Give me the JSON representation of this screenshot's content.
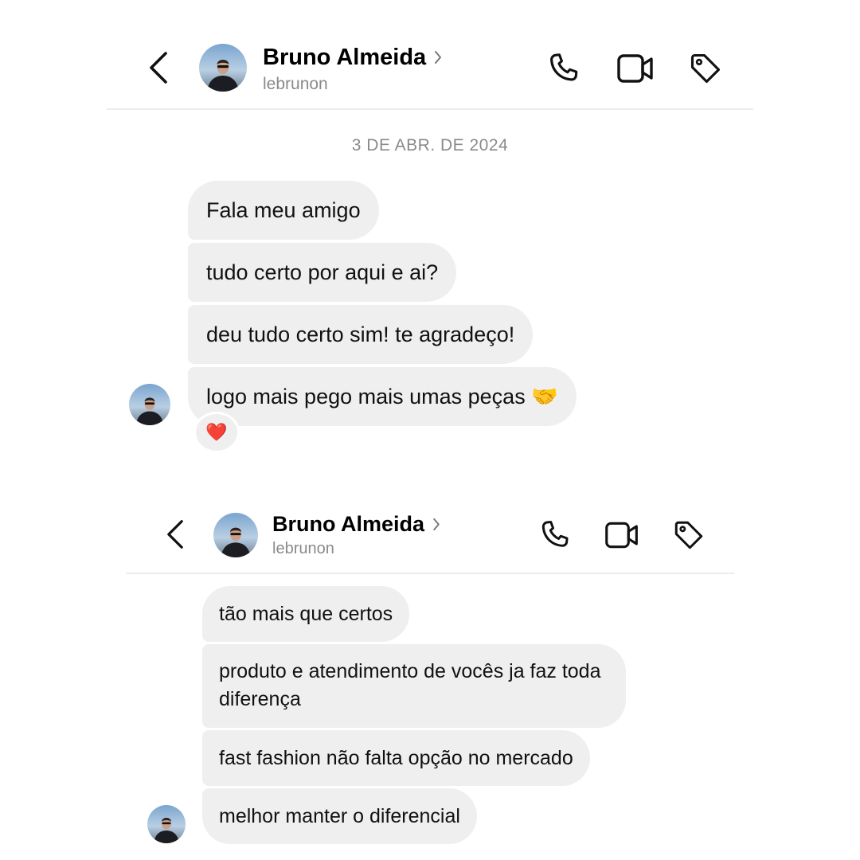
{
  "conversation_1": {
    "header": {
      "contact_name": "Bruno Almeida",
      "username": "lebrunon",
      "icons": {
        "back": "chevron-left-icon",
        "profile_chevron": "chevron-right-icon",
        "call": "phone-icon",
        "video": "video-camera-icon",
        "tag": "tag-icon"
      }
    },
    "date_separator": "3 DE ABR. DE 2024",
    "messages": [
      {
        "text": "Fala meu amigo"
      },
      {
        "text": "tudo certo por aqui e ai?"
      },
      {
        "text": "deu tudo certo sim! te agradeço!"
      },
      {
        "text": "logo mais pego mais umas peças 🤝",
        "reaction": "❤️"
      }
    ]
  },
  "conversation_2": {
    "header": {
      "contact_name": "Bruno Almeida",
      "username": "lebrunon"
    },
    "messages": [
      {
        "text": "tão mais que certos"
      },
      {
        "text": "produto e atendimento de vocês ja faz toda diferença"
      },
      {
        "text": "fast fashion não falta opção no mercado"
      },
      {
        "text": "melhor manter o diferencial"
      }
    ]
  },
  "colors": {
    "bubble_background": "#efefef",
    "secondary_text": "#8a8a8a",
    "divider": "#ececec",
    "heart": "#e0182d"
  }
}
